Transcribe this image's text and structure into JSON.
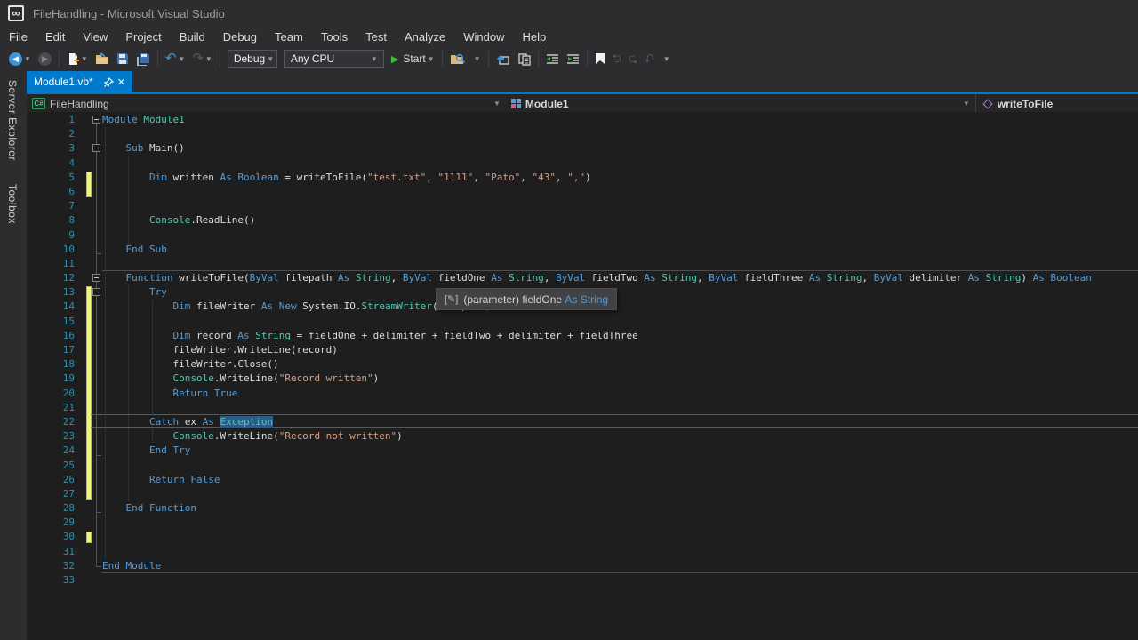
{
  "window": {
    "title": "FileHandling - Microsoft Visual Studio",
    "logo": "vs-logo"
  },
  "menu": {
    "items": [
      "File",
      "Edit",
      "View",
      "Project",
      "Build",
      "Debug",
      "Team",
      "Tools",
      "Test",
      "Analyze",
      "Window",
      "Help"
    ]
  },
  "toolbar": {
    "debug_config": "Debug",
    "platform": "Any CPU",
    "start_label": "Start",
    "icons": [
      "navigate-back",
      "navigate-forward",
      "new-file",
      "open-file",
      "save",
      "save-all",
      "undo",
      "redo",
      "find-in-files",
      "attach",
      "copy-structure",
      "indent",
      "outdent",
      "bookmark",
      "prev-bookmark",
      "next-bookmark",
      "clear-bookmarks"
    ]
  },
  "side_dock": {
    "tabs": [
      "Server Explorer",
      "Toolbox"
    ]
  },
  "tab_bar": {
    "tabs": [
      {
        "label": "Module1.vb*",
        "active": true,
        "icons": [
          "pin-icon",
          "close-icon"
        ]
      }
    ]
  },
  "nav_bar": {
    "project": "FileHandling",
    "project_icon": "csharp-project-icon",
    "type": "Module1",
    "type_icon": "module-icon",
    "member": "writeToFile",
    "member_icon": "method-icon"
  },
  "tooltip": {
    "icon": "parameter-icon",
    "icon_glyph": "[✎]",
    "label": "(parameter) fieldOne ",
    "type": "As String"
  },
  "editor": {
    "total_lines": 33,
    "current_line": 22,
    "changed_ranges": [
      [
        5,
        6
      ],
      [
        13,
        27
      ],
      [
        30,
        30
      ]
    ],
    "fold_open_lines": [
      1,
      3,
      12,
      13
    ],
    "fold_end_lines": [
      10,
      24,
      28
    ],
    "fold_close_line": 32,
    "separators_after_lines": [
      11,
      32
    ],
    "guides": [
      {
        "level": 0,
        "from": 2,
        "to": 31
      },
      {
        "level": 1,
        "from": 4,
        "to": 9
      },
      {
        "level": 1,
        "from": 13,
        "to": 27
      },
      {
        "level": 2,
        "from": 14,
        "to": 21
      },
      {
        "level": 2,
        "from": 23,
        "to": 23
      }
    ],
    "colors": {
      "keyword": "#569cd6",
      "type": "#4ec9b0",
      "string": "#d69d85",
      "plain": "#dcdcdc",
      "line_number": "#2b91af",
      "selection": "#2d5c8c",
      "change_bar": "#eff284",
      "background": "#1e1e1e",
      "accent": "#007acc"
    },
    "lines": {
      "1": [
        [
          "k",
          "Module"
        ],
        [
          "p",
          " "
        ],
        [
          "t",
          "Module1"
        ]
      ],
      "3": [
        [
          "p",
          "    "
        ],
        [
          "k",
          "Sub"
        ],
        [
          "p",
          " Main()"
        ]
      ],
      "5": [
        [
          "p",
          "        "
        ],
        [
          "k",
          "Dim"
        ],
        [
          "p",
          " written "
        ],
        [
          "k",
          "As"
        ],
        [
          "p",
          " "
        ],
        [
          "k",
          "Boolean"
        ],
        [
          "p",
          " = writeToFile("
        ],
        [
          "s",
          "\"test.txt\""
        ],
        [
          "p",
          ", "
        ],
        [
          "s",
          "\"1111\""
        ],
        [
          "p",
          ", "
        ],
        [
          "s",
          "\"Pato\""
        ],
        [
          "p",
          ", "
        ],
        [
          "s",
          "\"43\""
        ],
        [
          "p",
          ", "
        ],
        [
          "s",
          "\",\""
        ],
        [
          "p",
          ")"
        ]
      ],
      "8": [
        [
          "p",
          "        "
        ],
        [
          "t",
          "Console"
        ],
        [
          "p",
          ".ReadLine()"
        ]
      ],
      "10": [
        [
          "p",
          "    "
        ],
        [
          "k",
          "End Sub"
        ]
      ],
      "12": [
        [
          "p",
          "    "
        ],
        [
          "k",
          "Function"
        ],
        [
          "p",
          " "
        ],
        [
          "u",
          "writeToFile"
        ],
        [
          "p",
          "("
        ],
        [
          "k",
          "ByVal"
        ],
        [
          "p",
          " filepath "
        ],
        [
          "k",
          "As"
        ],
        [
          "p",
          " "
        ],
        [
          "t",
          "String"
        ],
        [
          "p",
          ", "
        ],
        [
          "k",
          "ByVal"
        ],
        [
          "p",
          " fieldOne "
        ],
        [
          "k",
          "As"
        ],
        [
          "p",
          " "
        ],
        [
          "t",
          "String"
        ],
        [
          "p",
          ", "
        ],
        [
          "k",
          "ByVal"
        ],
        [
          "p",
          " fieldTwo "
        ],
        [
          "k",
          "As"
        ],
        [
          "p",
          " "
        ],
        [
          "t",
          "String"
        ],
        [
          "p",
          ", "
        ],
        [
          "k",
          "ByVal"
        ],
        [
          "p",
          " fieldThree "
        ],
        [
          "k",
          "As"
        ],
        [
          "p",
          " "
        ],
        [
          "t",
          "String"
        ],
        [
          "p",
          ", "
        ],
        [
          "k",
          "ByVal"
        ],
        [
          "p",
          " delimiter "
        ],
        [
          "k",
          "As"
        ],
        [
          "p",
          " "
        ],
        [
          "t",
          "String"
        ],
        [
          "p",
          ") "
        ],
        [
          "k",
          "As"
        ],
        [
          "p",
          " "
        ],
        [
          "k",
          "Boolean"
        ]
      ],
      "13": [
        [
          "p",
          "        "
        ],
        [
          "k",
          "Try"
        ]
      ],
      "14": [
        [
          "p",
          "            "
        ],
        [
          "k",
          "Dim"
        ],
        [
          "p",
          " fileWriter "
        ],
        [
          "k",
          "As"
        ],
        [
          "p",
          " "
        ],
        [
          "k",
          "New"
        ],
        [
          "p",
          " System.IO."
        ],
        [
          "t",
          "StreamWriter"
        ],
        [
          "p",
          "(filepath)"
        ]
      ],
      "16": [
        [
          "p",
          "            "
        ],
        [
          "k",
          "Dim"
        ],
        [
          "p",
          " record "
        ],
        [
          "k",
          "As"
        ],
        [
          "p",
          " "
        ],
        [
          "t",
          "String"
        ],
        [
          "p",
          " = fieldOne + delimiter + fieldTwo + delimiter + fieldThree"
        ]
      ],
      "17": [
        [
          "p",
          "            fileWriter.WriteLine(record)"
        ]
      ],
      "18": [
        [
          "p",
          "            fileWriter.Close()"
        ]
      ],
      "19": [
        [
          "p",
          "            "
        ],
        [
          "t",
          "Console"
        ],
        [
          "p",
          ".WriteLine("
        ],
        [
          "s",
          "\"Record written\""
        ],
        [
          "p",
          ")"
        ]
      ],
      "20": [
        [
          "p",
          "            "
        ],
        [
          "k",
          "Return"
        ],
        [
          "p",
          " "
        ],
        [
          "k",
          "True"
        ]
      ],
      "22": [
        [
          "p",
          "        "
        ],
        [
          "k",
          "Catch"
        ],
        [
          "p",
          " ex "
        ],
        [
          "k",
          "As"
        ],
        [
          "p",
          " "
        ],
        [
          "x",
          "Exception"
        ]
      ],
      "23": [
        [
          "p",
          "            "
        ],
        [
          "t",
          "Console"
        ],
        [
          "p",
          ".WriteLine("
        ],
        [
          "s",
          "\"Record not written\""
        ],
        [
          "p",
          ")"
        ]
      ],
      "24": [
        [
          "p",
          "        "
        ],
        [
          "k",
          "End Try"
        ]
      ],
      "26": [
        [
          "p",
          "        "
        ],
        [
          "k",
          "Return"
        ],
        [
          "p",
          " "
        ],
        [
          "k",
          "False"
        ]
      ],
      "28": [
        [
          "p",
          "    "
        ],
        [
          "k",
          "End Function"
        ]
      ],
      "32": [
        [
          "k",
          "End Module"
        ]
      ]
    }
  }
}
